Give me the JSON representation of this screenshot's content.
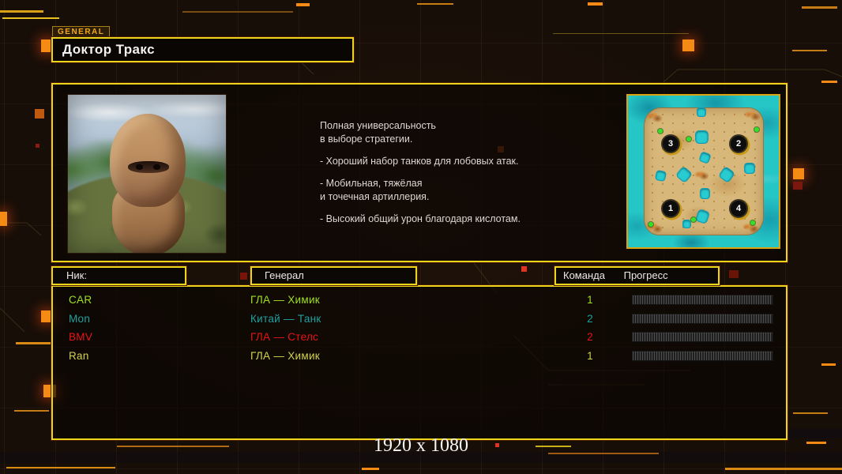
{
  "header": {
    "tab_label": "GENERAL",
    "general_name": "Доктор Тракс"
  },
  "profile": {
    "description": [
      {
        "lines": [
          "Полная универсальность",
          "в выборе стратегии."
        ]
      },
      {
        "lines": [
          "- Хороший набор танков для лобовых атак."
        ]
      },
      {
        "lines": [
          "- Мобильная, тяжёлая",
          "и точечная артиллерия."
        ]
      },
      {
        "lines": [
          "- Высокий общий урон благодаря кислотам."
        ]
      }
    ]
  },
  "map_preview": {
    "markers": [
      {
        "label": "3"
      },
      {
        "label": "2"
      },
      {
        "label": "1"
      },
      {
        "label": "4"
      }
    ],
    "water_color": "#25c6c6",
    "sand_color": "#d8b87a"
  },
  "players": {
    "columns": {
      "nick": "Ник:",
      "general": "Генерал",
      "team": "Команда",
      "progress": "Прогресс"
    },
    "rows": [
      {
        "nick": "CAR",
        "general": "ГЛА — Химик",
        "team": "1",
        "color": "#a0e020"
      },
      {
        "nick": "Mon",
        "general": "Китай — Танк",
        "team": "2",
        "color": "#1fa0a0"
      },
      {
        "nick": "BMV",
        "general": "ГЛА — Стелс",
        "team": "2",
        "color": "#e81414"
      },
      {
        "nick": "Ran",
        "general": "ГЛА — Химик",
        "team": "1",
        "color": "#d2d24e"
      }
    ]
  },
  "footer": {
    "resolution_text": "1920 x 1080"
  },
  "colors": {
    "panel_border": "#ecd61c",
    "decor_orange": "#f58a14",
    "tab_text": "#f2a81c"
  }
}
